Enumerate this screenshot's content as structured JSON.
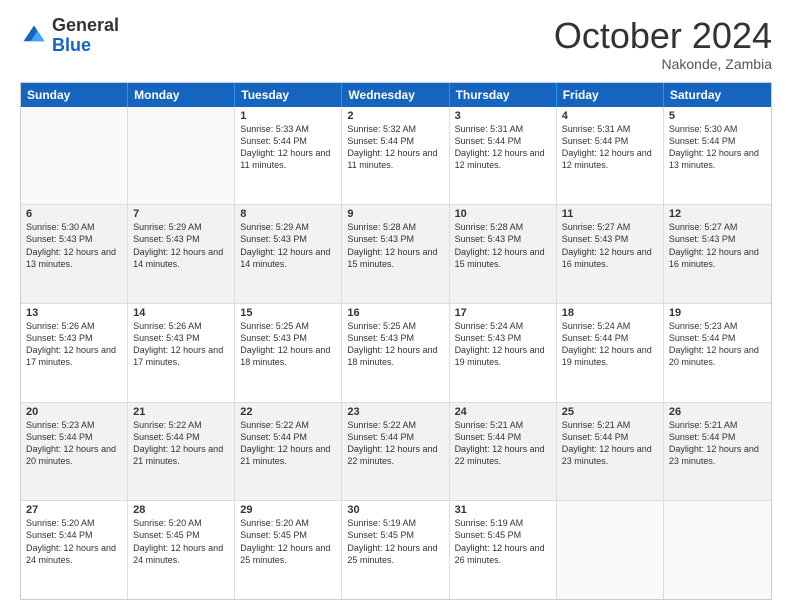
{
  "logo": {
    "general": "General",
    "blue": "Blue"
  },
  "header": {
    "month": "October 2024",
    "location": "Nakonde, Zambia"
  },
  "weekdays": [
    "Sunday",
    "Monday",
    "Tuesday",
    "Wednesday",
    "Thursday",
    "Friday",
    "Saturday"
  ],
  "weeks": [
    [
      {
        "day": "",
        "sunrise": "",
        "sunset": "",
        "daylight": ""
      },
      {
        "day": "",
        "sunrise": "",
        "sunset": "",
        "daylight": ""
      },
      {
        "day": "1",
        "sunrise": "Sunrise: 5:33 AM",
        "sunset": "Sunset: 5:44 PM",
        "daylight": "Daylight: 12 hours and 11 minutes."
      },
      {
        "day": "2",
        "sunrise": "Sunrise: 5:32 AM",
        "sunset": "Sunset: 5:44 PM",
        "daylight": "Daylight: 12 hours and 11 minutes."
      },
      {
        "day": "3",
        "sunrise": "Sunrise: 5:31 AM",
        "sunset": "Sunset: 5:44 PM",
        "daylight": "Daylight: 12 hours and 12 minutes."
      },
      {
        "day": "4",
        "sunrise": "Sunrise: 5:31 AM",
        "sunset": "Sunset: 5:44 PM",
        "daylight": "Daylight: 12 hours and 12 minutes."
      },
      {
        "day": "5",
        "sunrise": "Sunrise: 5:30 AM",
        "sunset": "Sunset: 5:44 PM",
        "daylight": "Daylight: 12 hours and 13 minutes."
      }
    ],
    [
      {
        "day": "6",
        "sunrise": "Sunrise: 5:30 AM",
        "sunset": "Sunset: 5:43 PM",
        "daylight": "Daylight: 12 hours and 13 minutes."
      },
      {
        "day": "7",
        "sunrise": "Sunrise: 5:29 AM",
        "sunset": "Sunset: 5:43 PM",
        "daylight": "Daylight: 12 hours and 14 minutes."
      },
      {
        "day": "8",
        "sunrise": "Sunrise: 5:29 AM",
        "sunset": "Sunset: 5:43 PM",
        "daylight": "Daylight: 12 hours and 14 minutes."
      },
      {
        "day": "9",
        "sunrise": "Sunrise: 5:28 AM",
        "sunset": "Sunset: 5:43 PM",
        "daylight": "Daylight: 12 hours and 15 minutes."
      },
      {
        "day": "10",
        "sunrise": "Sunrise: 5:28 AM",
        "sunset": "Sunset: 5:43 PM",
        "daylight": "Daylight: 12 hours and 15 minutes."
      },
      {
        "day": "11",
        "sunrise": "Sunrise: 5:27 AM",
        "sunset": "Sunset: 5:43 PM",
        "daylight": "Daylight: 12 hours and 16 minutes."
      },
      {
        "day": "12",
        "sunrise": "Sunrise: 5:27 AM",
        "sunset": "Sunset: 5:43 PM",
        "daylight": "Daylight: 12 hours and 16 minutes."
      }
    ],
    [
      {
        "day": "13",
        "sunrise": "Sunrise: 5:26 AM",
        "sunset": "Sunset: 5:43 PM",
        "daylight": "Daylight: 12 hours and 17 minutes."
      },
      {
        "day": "14",
        "sunrise": "Sunrise: 5:26 AM",
        "sunset": "Sunset: 5:43 PM",
        "daylight": "Daylight: 12 hours and 17 minutes."
      },
      {
        "day": "15",
        "sunrise": "Sunrise: 5:25 AM",
        "sunset": "Sunset: 5:43 PM",
        "daylight": "Daylight: 12 hours and 18 minutes."
      },
      {
        "day": "16",
        "sunrise": "Sunrise: 5:25 AM",
        "sunset": "Sunset: 5:43 PM",
        "daylight": "Daylight: 12 hours and 18 minutes."
      },
      {
        "day": "17",
        "sunrise": "Sunrise: 5:24 AM",
        "sunset": "Sunset: 5:43 PM",
        "daylight": "Daylight: 12 hours and 19 minutes."
      },
      {
        "day": "18",
        "sunrise": "Sunrise: 5:24 AM",
        "sunset": "Sunset: 5:44 PM",
        "daylight": "Daylight: 12 hours and 19 minutes."
      },
      {
        "day": "19",
        "sunrise": "Sunrise: 5:23 AM",
        "sunset": "Sunset: 5:44 PM",
        "daylight": "Daylight: 12 hours and 20 minutes."
      }
    ],
    [
      {
        "day": "20",
        "sunrise": "Sunrise: 5:23 AM",
        "sunset": "Sunset: 5:44 PM",
        "daylight": "Daylight: 12 hours and 20 minutes."
      },
      {
        "day": "21",
        "sunrise": "Sunrise: 5:22 AM",
        "sunset": "Sunset: 5:44 PM",
        "daylight": "Daylight: 12 hours and 21 minutes."
      },
      {
        "day": "22",
        "sunrise": "Sunrise: 5:22 AM",
        "sunset": "Sunset: 5:44 PM",
        "daylight": "Daylight: 12 hours and 21 minutes."
      },
      {
        "day": "23",
        "sunrise": "Sunrise: 5:22 AM",
        "sunset": "Sunset: 5:44 PM",
        "daylight": "Daylight: 12 hours and 22 minutes."
      },
      {
        "day": "24",
        "sunrise": "Sunrise: 5:21 AM",
        "sunset": "Sunset: 5:44 PM",
        "daylight": "Daylight: 12 hours and 22 minutes."
      },
      {
        "day": "25",
        "sunrise": "Sunrise: 5:21 AM",
        "sunset": "Sunset: 5:44 PM",
        "daylight": "Daylight: 12 hours and 23 minutes."
      },
      {
        "day": "26",
        "sunrise": "Sunrise: 5:21 AM",
        "sunset": "Sunset: 5:44 PM",
        "daylight": "Daylight: 12 hours and 23 minutes."
      }
    ],
    [
      {
        "day": "27",
        "sunrise": "Sunrise: 5:20 AM",
        "sunset": "Sunset: 5:44 PM",
        "daylight": "Daylight: 12 hours and 24 minutes."
      },
      {
        "day": "28",
        "sunrise": "Sunrise: 5:20 AM",
        "sunset": "Sunset: 5:45 PM",
        "daylight": "Daylight: 12 hours and 24 minutes."
      },
      {
        "day": "29",
        "sunrise": "Sunrise: 5:20 AM",
        "sunset": "Sunset: 5:45 PM",
        "daylight": "Daylight: 12 hours and 25 minutes."
      },
      {
        "day": "30",
        "sunrise": "Sunrise: 5:19 AM",
        "sunset": "Sunset: 5:45 PM",
        "daylight": "Daylight: 12 hours and 25 minutes."
      },
      {
        "day": "31",
        "sunrise": "Sunrise: 5:19 AM",
        "sunset": "Sunset: 5:45 PM",
        "daylight": "Daylight: 12 hours and 26 minutes."
      },
      {
        "day": "",
        "sunrise": "",
        "sunset": "",
        "daylight": ""
      },
      {
        "day": "",
        "sunrise": "",
        "sunset": "",
        "daylight": ""
      }
    ]
  ]
}
